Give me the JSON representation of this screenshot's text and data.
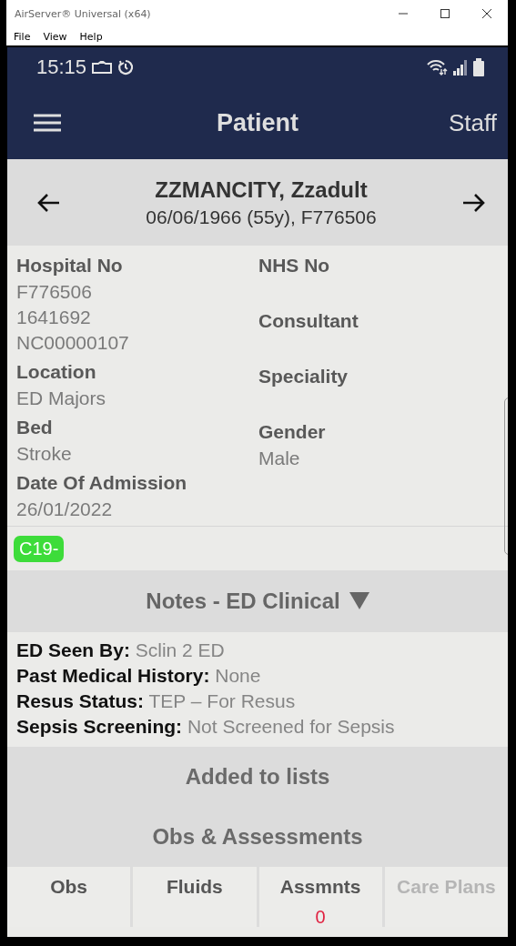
{
  "window": {
    "title": "AirServer® Universal (x64)",
    "menu": [
      "File",
      "View",
      "Help"
    ]
  },
  "status_bar": {
    "time": "15:15"
  },
  "app_bar": {
    "title": "Patient",
    "action": "Staff"
  },
  "patient": {
    "name": "ZZMANCITY, Zzadult",
    "subtitle": "06/06/1966 (55y), F776506"
  },
  "details": {
    "left": [
      {
        "label": "Hospital No",
        "values": [
          "F776506",
          "1641692",
          "NC00000107"
        ]
      },
      {
        "label": "Location",
        "values": [
          "ED Majors"
        ]
      },
      {
        "label": "Bed",
        "values": [
          "Stroke"
        ]
      },
      {
        "label": "Date Of Admission",
        "values": [
          "26/01/2022"
        ]
      }
    ],
    "right": [
      {
        "label": "NHS No"
      },
      {
        "label": "Consultant"
      },
      {
        "label": "Speciality"
      },
      {
        "label": "Gender",
        "values": [
          "Male"
        ]
      }
    ]
  },
  "tags": [
    {
      "label": "C19-",
      "color": "#3ddc3a"
    }
  ],
  "notes": {
    "title": "Notes - ED Clinical",
    "expanded": true,
    "fields": [
      {
        "label": "ED Seen By:",
        "value": "Sclin 2 ED"
      },
      {
        "label": "Past Medical History:",
        "value": "None"
      },
      {
        "label": "Resus Status:",
        "value": "TEP – For Resus"
      },
      {
        "label": "Sepsis Screening:",
        "value": "Not Screened for Sepsis"
      }
    ]
  },
  "sections": [
    {
      "title": "Added to lists"
    },
    {
      "title": "Obs & Assessments"
    }
  ],
  "tabs": [
    {
      "label": "Obs",
      "disabled": false
    },
    {
      "label": "Fluids",
      "disabled": false
    },
    {
      "label": "Assmnts",
      "disabled": false,
      "count": "0"
    },
    {
      "label": "Care Plans",
      "disabled": true
    }
  ]
}
